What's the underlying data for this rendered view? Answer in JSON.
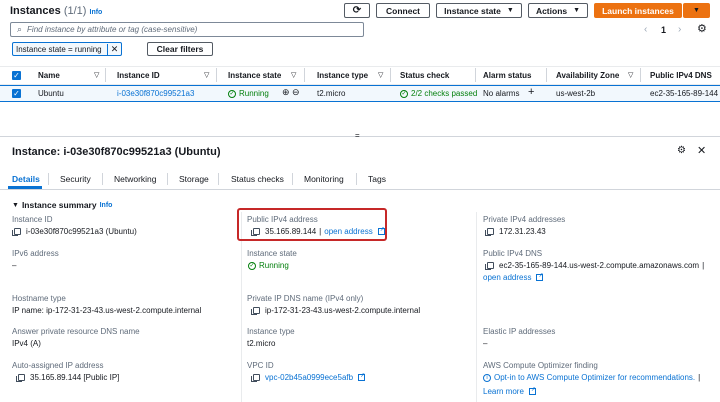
{
  "header": {
    "title": "Instances",
    "count": "(1/1)",
    "info": "Info",
    "connect": "Connect",
    "instance_state": "Instance state",
    "actions": "Actions",
    "launch": "Launch instances",
    "page": "1"
  },
  "search": {
    "placeholder": "Find instance by attribute or tag (case-sensitive)"
  },
  "filter": {
    "token": "Instance state = running",
    "clear": "Clear filters"
  },
  "table": {
    "columns": [
      "Name",
      "Instance ID",
      "Instance state",
      "Instance type",
      "Status check",
      "Alarm status",
      "Availability Zone",
      "Public IPv4 DNS"
    ],
    "row": {
      "name": "Ubuntu",
      "id": "i-03e30f870c99521a3",
      "state": "Running",
      "type": "t2.micro",
      "status": "2/2 checks passed",
      "alarm": "No alarms",
      "az": "us-west-2b",
      "dns": "ec2-35-165-89-144"
    }
  },
  "detail": {
    "title": "Instance: i-03e30f870c99521a3 (Ubuntu)",
    "tabs": [
      "Details",
      "Security",
      "Networking",
      "Storage",
      "Status checks",
      "Monitoring",
      "Tags"
    ],
    "summary_label": "Instance summary",
    "summary_info": "Info",
    "fields": {
      "instance_id_label": "Instance ID",
      "instance_id": "i-03e30f870c99521a3 (Ubuntu)",
      "public_ip_label": "Public IPv4 address",
      "public_ip": "35.165.89.144",
      "open_address": "open address",
      "private_ip_label": "Private IPv4 addresses",
      "private_ip": "172.31.23.43",
      "ipv6_label": "IPv6 address",
      "ipv6": "–",
      "state_label": "Instance state",
      "state": "Running",
      "public_dns_label": "Public IPv4 DNS",
      "public_dns": "ec2-35-165-89-144.us-west-2.compute.amazonaws.com",
      "hostname_type_label": "Hostname type",
      "hostname_type": "IP name: ip-172-31-23-43.us-west-2.compute.internal",
      "private_dns_label": "Private IP DNS name (IPv4 only)",
      "private_dns": "ip-172-31-23-43.us-west-2.compute.internal",
      "answer_dns_label": "Answer private resource DNS name",
      "answer_dns": "IPv4 (A)",
      "instance_type_label": "Instance type",
      "instance_type": "t2.micro",
      "elastic_ip_label": "Elastic IP addresses",
      "elastic_ip": "–",
      "auto_ip_label": "Auto-assigned IP address",
      "auto_ip": "35.165.89.144 [Public IP]",
      "vpc_label": "VPC ID",
      "vpc": "vpc-02b45a0999ece5afb",
      "optimizer_label": "AWS Compute Optimizer finding",
      "optimizer": "Opt-in to AWS Compute Optimizer for recommendations.",
      "learn_more": "Learn more"
    }
  },
  "colors": {
    "accent": "#0972d3",
    "launch": "#ec7211",
    "highlight": "#c62828",
    "ok": "#037f0c"
  }
}
